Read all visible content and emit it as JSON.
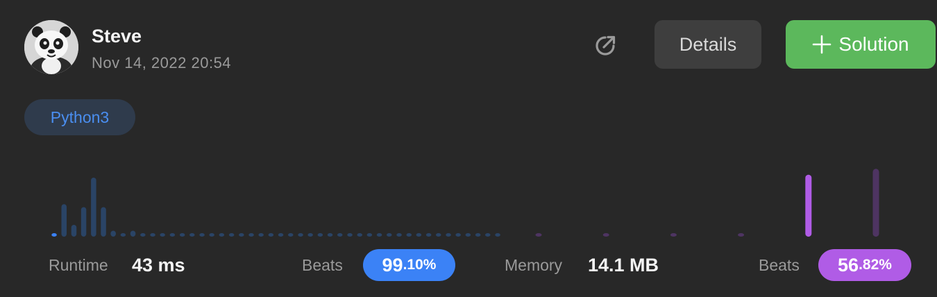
{
  "user": {
    "name": "Steve",
    "timestamp": "Nov 14, 2022 20:54"
  },
  "actions": {
    "details_label": "Details",
    "solution_label": "Solution"
  },
  "language": "Python3",
  "runtime": {
    "label": "Runtime",
    "value": "43 ms",
    "beats_label": "Beats",
    "beats_int": "99",
    "beats_dec": ".10%",
    "color": "#3b82f6"
  },
  "memory": {
    "label": "Memory",
    "value": "14.1 MB",
    "beats_label": "Beats",
    "beats_int": "56",
    "beats_dec": ".82%",
    "color": "#b05ce6"
  },
  "chart_data": [
    {
      "type": "bar",
      "title": "",
      "xlabel": "",
      "ylabel": "",
      "values": [
        1,
        11,
        4,
        10,
        20,
        10,
        2,
        1,
        2,
        1,
        1,
        1,
        1,
        1,
        1,
        1,
        1,
        1,
        1,
        1,
        1,
        1,
        1,
        1,
        1,
        1,
        1,
        1,
        1,
        1,
        1,
        1,
        1,
        1,
        1,
        1,
        1,
        1,
        1,
        1,
        1,
        1,
        1,
        1,
        1,
        1
      ],
      "highlight_index": 0,
      "color": "#2a4466",
      "highlight_color": "#3b82f6"
    },
    {
      "type": "bar",
      "title": "",
      "xlabel": "",
      "ylabel": "",
      "values": [
        1,
        1,
        1,
        1,
        21,
        23
      ],
      "highlight_index": 4,
      "color": "#4e3462",
      "highlight_color": "#b05ce6"
    }
  ]
}
